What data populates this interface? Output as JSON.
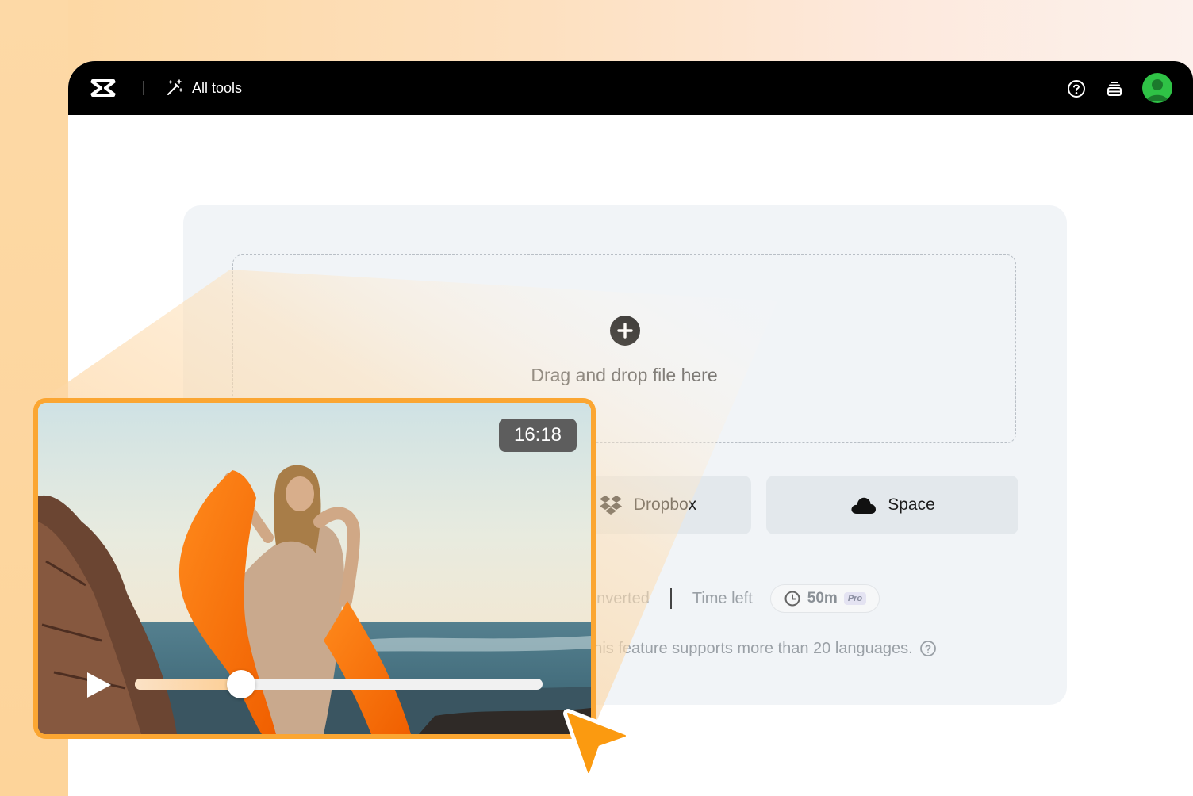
{
  "topbar": {
    "all_tools_label": "All tools"
  },
  "upload": {
    "drop_text": "Drag and drop file here",
    "dropbox_label": "Dropbox",
    "space_label": "Space"
  },
  "stats": {
    "converted_label": "converted",
    "time_left_label": "Time left",
    "time_value": "50m",
    "pro_badge": "Pro"
  },
  "supports_text": "This feature supports more than 20 languages.",
  "video": {
    "timestamp": "16:18",
    "progress": 0.26
  },
  "colors": {
    "accent_orange": "#fba632",
    "topbar_bg": "#000000",
    "avatar_green": "#2fc246",
    "panel_bg": "#f1f4f7"
  },
  "icons": {
    "logo": "capcut-logo-icon",
    "all_tools": "magic-wand-icon",
    "help": "help-icon",
    "stack": "stack-icon",
    "plus": "plus-circle-icon",
    "dropbox": "dropbox-icon",
    "space": "cloud-icon",
    "clock": "clock-icon",
    "play": "play-icon",
    "cursor": "cursor-pointer-icon"
  }
}
